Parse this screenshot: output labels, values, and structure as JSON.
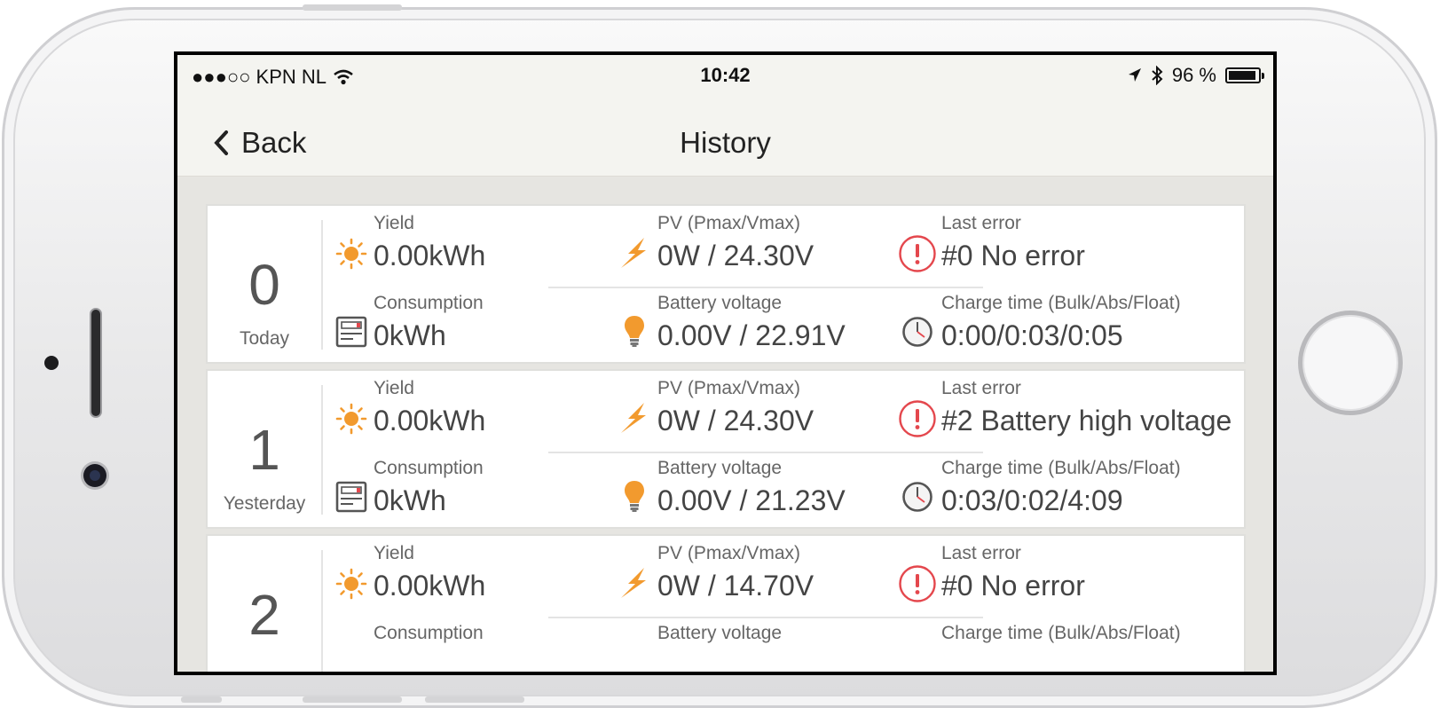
{
  "status": {
    "carrier": "●●●○○ KPN NL",
    "time": "10:42",
    "battery": "96 %"
  },
  "nav": {
    "back_label": "Back",
    "title": "History"
  },
  "labels": {
    "yield": "Yield",
    "pv": "PV (Pmax/Vmax)",
    "last_error": "Last error",
    "consumption": "Consumption",
    "battery_voltage": "Battery voltage",
    "charge_time": "Charge time (Bulk/Abs/Float)"
  },
  "days": [
    {
      "num": "0",
      "label": "Today",
      "yield": "0.00kWh",
      "pv": "0W / 24.30V",
      "error": "#0 No error",
      "consumption": "0kWh",
      "battery": "0.00V / 22.91V",
      "charge": "0:00/0:03/0:05"
    },
    {
      "num": "1",
      "label": "Yesterday",
      "yield": "0.00kWh",
      "pv": "0W / 24.30V",
      "error": "#2 Battery high voltage",
      "consumption": "0kWh",
      "battery": "0.00V / 21.23V",
      "charge": "0:03/0:02/4:09"
    },
    {
      "num": "2",
      "label": "",
      "yield": "0.00kWh",
      "pv": "0W / 14.70V",
      "error": "#0 No error",
      "consumption": "",
      "battery": "",
      "charge": ""
    }
  ],
  "colors": {
    "accent": "#f29a2e",
    "error": "#e4474d",
    "icon_gray": "#555555"
  },
  "icons": [
    "sun-icon",
    "lightning-icon",
    "error-icon",
    "meter-icon",
    "bulb-icon",
    "clock-icon"
  ]
}
